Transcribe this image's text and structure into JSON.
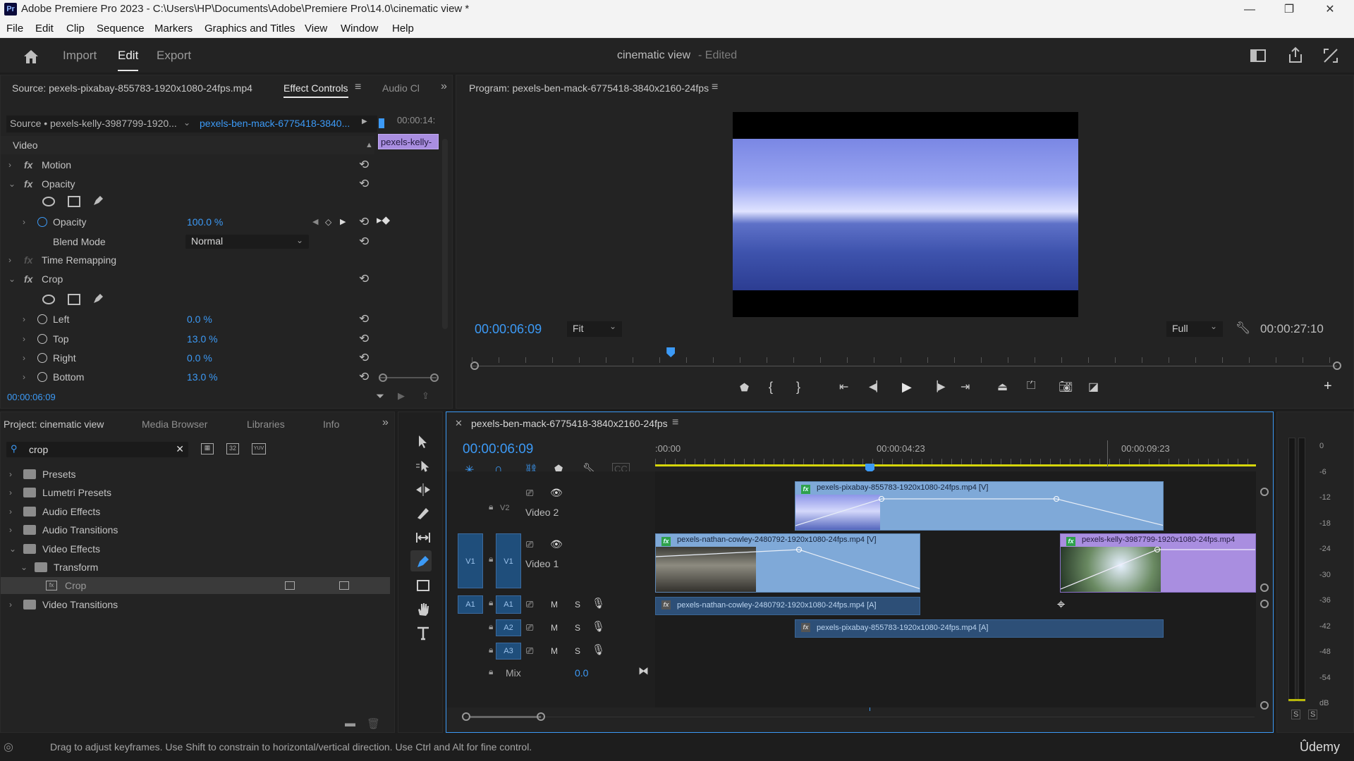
{
  "window": {
    "title": "Adobe Premiere Pro 2023 - C:\\Users\\HP\\Documents\\Adobe\\Premiere Pro\\14.0\\cinematic view *",
    "app_icon": "Pr",
    "minimize": "—",
    "maximize": "❐",
    "close": "✕"
  },
  "menu": [
    "File",
    "Edit",
    "Clip",
    "Sequence",
    "Markers",
    "Graphics and Titles",
    "View",
    "Window",
    "Help"
  ],
  "header": {
    "tabs": [
      "Import",
      "Edit",
      "Export"
    ],
    "project_name": "cinematic view",
    "edited_label": "- Edited"
  },
  "effect_controls": {
    "source_tab": "Source: pexels-pixabay-855783-1920x1080-24fps.mp4",
    "active_tab": "Effect Controls",
    "audio_tab": "Audio Cl",
    "source_selector": "Source • pexels-kelly-3987799-1920...",
    "sequence_selector": "pexels-ben-mack-6775418-3840...",
    "mini_time": "00:00:14:",
    "mini_clip": "pexels-kelly-",
    "video_header": "Video",
    "motion": "Motion",
    "opacity_group": "Opacity",
    "opacity_label": "Opacity",
    "opacity_value": "100.0 %",
    "blend_mode_label": "Blend Mode",
    "blend_mode_value": "Normal",
    "time_remapping": "Time Remapping",
    "crop_group": "Crop",
    "left_label": "Left",
    "left_value": "0.0 %",
    "top_label": "Top",
    "top_value": "13.0 %",
    "right_label": "Right",
    "right_value": "0.0 %",
    "bottom_label": "Bottom",
    "bottom_value": "13.0 %",
    "current_time": "00:00:06:09"
  },
  "program": {
    "title": "Program: pexels-ben-mack-6775418-3840x2160-24fps",
    "timecode": "00:00:06:09",
    "fit": "Fit",
    "quality": "Full",
    "duration": "00:00:27:10",
    "playhead_fraction": 0.23
  },
  "project": {
    "tabs": [
      "Project: cinematic view",
      "Media Browser",
      "Libraries",
      "Info"
    ],
    "search_value": "crop",
    "tree": [
      {
        "label": "Presets",
        "level": 0,
        "open": false
      },
      {
        "label": "Lumetri Presets",
        "level": 0,
        "open": false
      },
      {
        "label": "Audio Effects",
        "level": 0,
        "open": false
      },
      {
        "label": "Audio Transitions",
        "level": 0,
        "open": false
      },
      {
        "label": "Video Effects",
        "level": 0,
        "open": true
      },
      {
        "label": "Transform",
        "level": 1,
        "open": true
      },
      {
        "label": "Crop",
        "level": 2,
        "open": false
      },
      {
        "label": "Video Transitions",
        "level": 0,
        "open": false
      }
    ],
    "badge_32": "32",
    "badge_yuv": "YUV"
  },
  "timeline": {
    "sequence_tab": "pexels-ben-mack-6775418-3840x2160-24fps",
    "timecode": "00:00:06:09",
    "ruler": [
      ":00:00",
      "00:00:04:23",
      "00:00:09:23"
    ],
    "tracks": {
      "v2": {
        "id": "V2",
        "name": "Video 2"
      },
      "v1": {
        "id": "V1",
        "src": "V1",
        "name": "Video 1"
      },
      "a1": {
        "id": "A1",
        "src": "A1"
      },
      "a2": {
        "id": "A2"
      },
      "a3": {
        "id": "A3"
      },
      "mix_label": "Mix",
      "mix_value": "0.0",
      "m": "M",
      "s": "S"
    },
    "clips": {
      "v2_clip": "pexels-pixabay-855783-1920x1080-24fps.mp4 [V]",
      "v1_clip_a": "pexels-nathan-cowley-2480792-1920x1080-24fps.mp4 [V]",
      "v1_clip_b": "pexels-kelly-3987799-1920x1080-24fps.mp4",
      "a1_clip": "pexels-nathan-cowley-2480792-1920x1080-24fps.mp4 [A]",
      "a2_clip": "pexels-pixabay-855783-1920x1080-24fps.mp4 [A]"
    }
  },
  "meters": {
    "scale": [
      "0",
      "-6",
      "-12",
      "-18",
      "-24",
      "-30",
      "-36",
      "-42",
      "-48",
      "-54",
      "dB"
    ],
    "solo": [
      "S",
      "S"
    ]
  },
  "status": {
    "message": "Drag to adjust keyframes. Use Shift to constrain to horizontal/vertical direction. Use Ctrl and Alt for fine control.",
    "watermark": "Ûdemy"
  },
  "colors": {
    "accent_blue": "#3c9af6",
    "clip_video": "#7fa9d8",
    "clip_purple": "#a98ee0",
    "clip_audio": "#2d4f77",
    "work_area": "#d6d60a"
  }
}
